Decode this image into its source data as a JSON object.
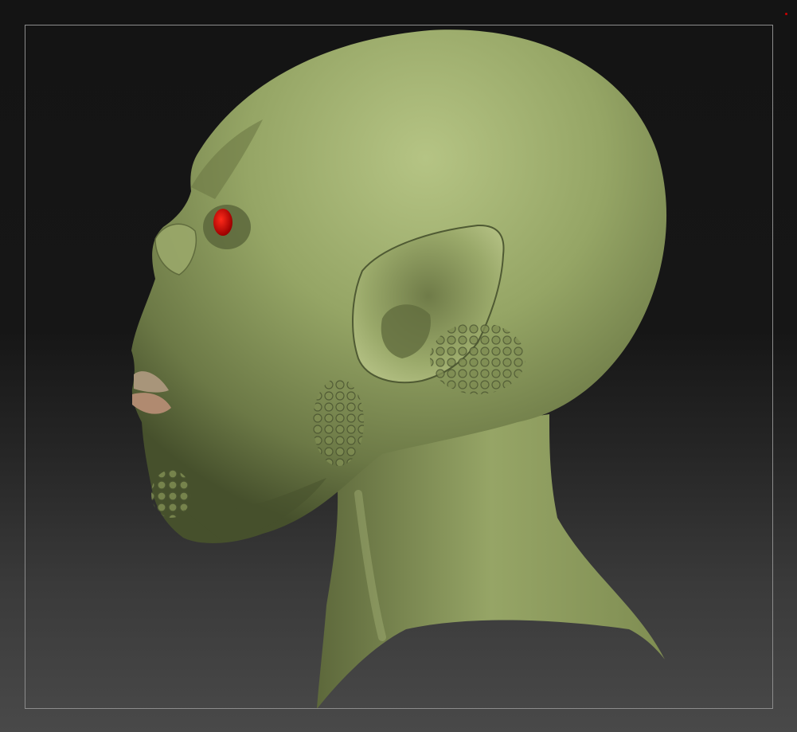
{
  "scene": {
    "subject_icon": "alien-head-model",
    "colors": {
      "skin_light": "#a8b878",
      "skin_mid": "#8c9c5e",
      "skin_dark": "#56603a",
      "skin_shadow": "#3a4126",
      "eye": "#d40000",
      "lips": "#b08a70",
      "frame": "#8c8c8c",
      "marker": "#cc0000"
    }
  }
}
